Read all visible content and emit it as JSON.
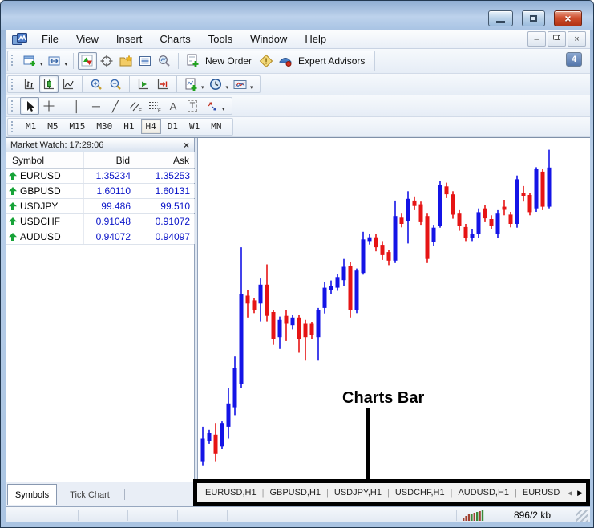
{
  "menu": {
    "items": [
      "File",
      "View",
      "Insert",
      "Charts",
      "Tools",
      "Window",
      "Help"
    ]
  },
  "toolbar": {
    "new_order_label": "New Order",
    "expert_advisors_label": "Expert Advisors",
    "notification_count": "4"
  },
  "icons": {
    "close_glyph": "×",
    "mdi_minimize_glyph": "–",
    "mdi_close_glyph": "×",
    "caret": "▾",
    "market_watch_close": "×",
    "vline_tool": "│",
    "hline_tool": "─",
    "trend_tool": "╱",
    "text_tool": "A",
    "text_label_tool": "T"
  },
  "timeframes": {
    "items": [
      "M1",
      "M5",
      "M15",
      "M30",
      "H1",
      "H4",
      "D1",
      "W1",
      "MN"
    ],
    "active": "H4"
  },
  "market_watch": {
    "title": "Market Watch: 17:29:06",
    "columns": [
      "Symbol",
      "Bid",
      "Ask"
    ],
    "rows": [
      {
        "symbol": "EURUSD",
        "bid": "1.35234",
        "ask": "1.35253"
      },
      {
        "symbol": "GBPUSD",
        "bid": "1.60110",
        "ask": "1.60131"
      },
      {
        "symbol": "USDJPY",
        "bid": "99.486",
        "ask": "99.510"
      },
      {
        "symbol": "USDCHF",
        "bid": "0.91048",
        "ask": "0.91072"
      },
      {
        "symbol": "AUDUSD",
        "bid": "0.94072",
        "ask": "0.94097"
      }
    ]
  },
  "dock_tabs": {
    "items": [
      "Symbols",
      "Tick Chart"
    ],
    "active": "Symbols"
  },
  "charts_bar": {
    "tabs": [
      "EURUSD,H1",
      "GBPUSD,H1",
      "USDJPY,H1",
      "USDCHF,H1",
      "AUDUSD,H1",
      "EURUSD"
    ],
    "separator": "|",
    "left_arrow": "◀",
    "right_arrow": "▶"
  },
  "annotation": {
    "label": "Charts Bar"
  },
  "status_bar": {
    "traffic": "896/2 kb"
  },
  "colors": {
    "bull": "#1414e6",
    "bear": "#e61414",
    "price_text": "#0a14c8",
    "arrow_green": "#17a338",
    "annotation": "#000000",
    "close_button": "#b13214",
    "titlebar": "#aac4e4"
  },
  "chart_data": {
    "type": "candlestick",
    "background": "#ffffff",
    "bull_color": "#1414e6",
    "bear_color": "#e61414",
    "axes_visible": false,
    "candles": [
      [
        5.7,
        15.9,
        4.5,
        12.5
      ],
      [
        11.8,
        15,
        11,
        14.1
      ],
      [
        13.6,
        17,
        5.7,
        8
      ],
      [
        10.2,
        17.5,
        9.5,
        17
      ],
      [
        15.9,
        27.3,
        12.5,
        22.7
      ],
      [
        21.6,
        36.4,
        19.3,
        33
      ],
      [
        28.4,
        68.2,
        27.3,
        54.5
      ],
      [
        54.1,
        55.7,
        47.7,
        51.8
      ],
      [
        52.7,
        53.5,
        49,
        50
      ],
      [
        51.8,
        59.1,
        46.6,
        57.3
      ],
      [
        57.3,
        63.2,
        46.6,
        48.2
      ],
      [
        49.3,
        50,
        39.8,
        41.4
      ],
      [
        42,
        48,
        38.6,
        47
      ],
      [
        48.2,
        50,
        40.9,
        45.9
      ],
      [
        45.5,
        48.5,
        44.3,
        47.7
      ],
      [
        47.7,
        48.5,
        37.5,
        41.4
      ],
      [
        45.9,
        47,
        35.2,
        42
      ],
      [
        45.9,
        46.5,
        41.5,
        42.7
      ],
      [
        42,
        50.5,
        35.2,
        50
      ],
      [
        50.5,
        58,
        48.9,
        56.4
      ],
      [
        55.7,
        58.5,
        54.5,
        57
      ],
      [
        56.4,
        60.5,
        55.5,
        59.5
      ],
      [
        58.6,
        64.8,
        56.8,
        62.5
      ],
      [
        62.7,
        64,
        47.7,
        50
      ],
      [
        50,
        62,
        49,
        61.4
      ],
      [
        60.7,
        72.7,
        60.2,
        70.5
      ],
      [
        70,
        72,
        69,
        71.1
      ],
      [
        71.1,
        72,
        67,
        68.2
      ],
      [
        68.9,
        70,
        64.5,
        65.9
      ],
      [
        66.8,
        67.5,
        63,
        64.3
      ],
      [
        64.3,
        81.8,
        63.6,
        77.3
      ],
      [
        76.8,
        78,
        74,
        75
      ],
      [
        75.9,
        84.5,
        69.3,
        82.3
      ],
      [
        81.8,
        83,
        79,
        80.2
      ],
      [
        80.7,
        81.5,
        74.5,
        75.5
      ],
      [
        77.3,
        78,
        63.6,
        64.8
      ],
      [
        69.8,
        74.5,
        68.5,
        73.9
      ],
      [
        74.3,
        87.5,
        73.9,
        86.4
      ],
      [
        85.9,
        87,
        82.5,
        83.6
      ],
      [
        83.6,
        84.5,
        76.5,
        77.7
      ],
      [
        78,
        79,
        73,
        74.3
      ],
      [
        74.1,
        75,
        70,
        70.9
      ],
      [
        70.9,
        73.5,
        70,
        72
      ],
      [
        72,
        79.5,
        71,
        78.4
      ],
      [
        79.5,
        80.5,
        75.5,
        76.6
      ],
      [
        76.4,
        77.5,
        73.5,
        74.3
      ],
      [
        72,
        79,
        71,
        78
      ],
      [
        80,
        82,
        77.5,
        79.1
      ],
      [
        77.7,
        78.5,
        74,
        75
      ],
      [
        75,
        89.1,
        73.9,
        88
      ],
      [
        84.1,
        86,
        81.5,
        83.2
      ],
      [
        83.4,
        84,
        77.5,
        78.4
      ],
      [
        79.5,
        91.5,
        78.5,
        90.9
      ],
      [
        90.2,
        91,
        79,
        80
      ],
      [
        80,
        96.6,
        79.5,
        91.4
      ]
    ]
  }
}
